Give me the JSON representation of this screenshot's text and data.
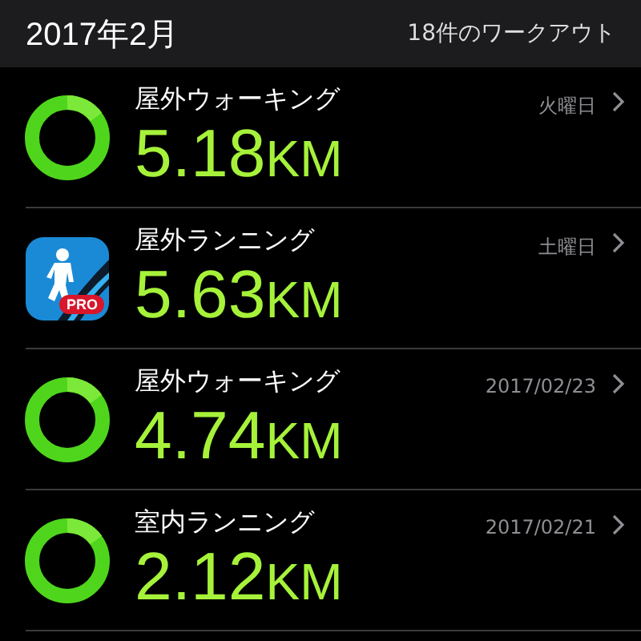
{
  "header": {
    "month": "2017年2月",
    "count": "18件のワークアウト"
  },
  "workouts": [
    {
      "kind": "ring",
      "name": "屋外ウォーキング",
      "value": "5.18",
      "unit": "KM",
      "date": "火曜日"
    },
    {
      "kind": "app",
      "badge": "PRO",
      "name": "屋外ランニング",
      "value": "5.63",
      "unit": "KM",
      "date": "土曜日"
    },
    {
      "kind": "ring",
      "name": "屋外ウォーキング",
      "value": "4.74",
      "unit": "KM",
      "date": "2017/02/23"
    },
    {
      "kind": "ring",
      "name": "室内ランニング",
      "value": "2.12",
      "unit": "KM",
      "date": "2017/02/21"
    }
  ]
}
